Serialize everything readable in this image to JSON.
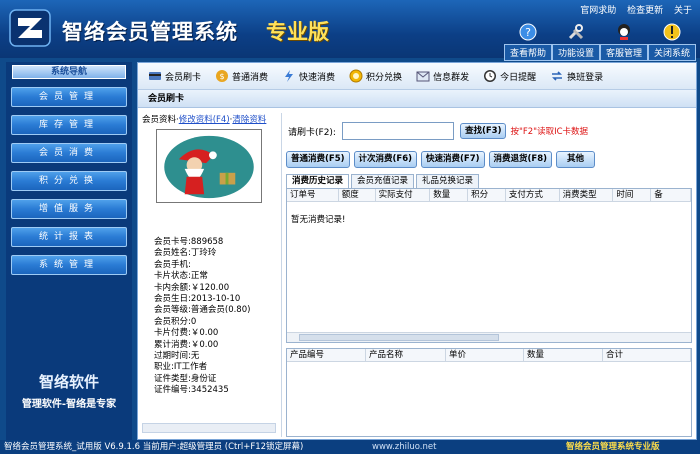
{
  "app": {
    "title": "智络会员管理系统",
    "edition": "专业版",
    "top_links": [
      "官网求助",
      "检查更新",
      "关于"
    ],
    "top_buttons": [
      {
        "label": "查看帮助",
        "icon": "help-icon"
      },
      {
        "label": "功能设置",
        "icon": "tools-icon"
      },
      {
        "label": "客服管理",
        "icon": "support-icon"
      },
      {
        "label": "关闭系统",
        "icon": "warning-icon"
      }
    ]
  },
  "sidebar": {
    "header": "系统导航",
    "items": [
      "会员管理",
      "库存管理",
      "会员消费",
      "积分兑换",
      "增值服务",
      "统计报表",
      "系统管理"
    ],
    "brand_name": "智络软件",
    "brand_slogan": "管理软件-智络是专家"
  },
  "toolbar": {
    "items": [
      {
        "label": "会员刷卡",
        "icon": "card-icon"
      },
      {
        "label": "普通消费",
        "icon": "money-icon"
      },
      {
        "label": "快速消费",
        "icon": "lightning-icon"
      },
      {
        "label": "积分兑换",
        "icon": "points-icon"
      },
      {
        "label": "信息群发",
        "icon": "message-icon"
      },
      {
        "label": "今日提醒",
        "icon": "clock-icon"
      },
      {
        "label": "换班登录",
        "icon": "swap-icon"
      }
    ]
  },
  "panel_title": "会员刷卡",
  "member": {
    "section_label": "会员资料",
    "edit_link": "修改资料(F4)",
    "clear_link": "清除资料",
    "fields": [
      {
        "label": "会员卡号:",
        "value": "889658"
      },
      {
        "label": "会员姓名:",
        "value": "丁玲玲"
      },
      {
        "label": "会员手机:",
        "value": ""
      },
      {
        "label": "卡片状态:",
        "value": "正常"
      },
      {
        "label": "卡内余额:",
        "value": "￥120.00"
      },
      {
        "label": "会员生日:",
        "value": "2013-10-10"
      },
      {
        "label": "会员等级:",
        "value": "普通会员(0.80)"
      },
      {
        "label": "会员积分:",
        "value": "0"
      },
      {
        "label": "卡片付费:",
        "value": "￥0.00"
      },
      {
        "label": "累计消费:",
        "value": "￥0.00"
      },
      {
        "label": "过期时间:",
        "value": "无"
      },
      {
        "label": "职业:",
        "value": "IT工作者"
      },
      {
        "label": "证件类型:",
        "value": "身份证"
      },
      {
        "label": "证件编号:",
        "value": "3452435"
      }
    ]
  },
  "card_entry": {
    "label": "请刷卡(F2):",
    "value": "",
    "find_button": "查找(F3)",
    "hint": "按\"F2\"读取IC卡数据"
  },
  "actions": [
    "普通消费(F5)",
    "计次消费(F6)",
    "快速消费(F7)",
    "消费退货(F8)",
    "其他"
  ],
  "tabs": [
    "消费历史记录",
    "会员充值记录",
    "礼品兑换记录"
  ],
  "history_table": {
    "columns": [
      "订单号",
      "额度",
      "实际支付",
      "数量",
      "积分",
      "支付方式",
      "消费类型",
      "时间",
      "备"
    ],
    "empty_text": "暂无消费记录!"
  },
  "product_table": {
    "columns": [
      "产品编号",
      "产品名称",
      "单价",
      "数量",
      "合计"
    ]
  },
  "statusbar": {
    "text": "智络会员管理系统_试用版 V6.9.1.6 当前用户:超级管理员 (Ctrl+F12锁定屏幕)",
    "site": "www.zhiluo.net",
    "brand": "智络会员管理系统专业版"
  }
}
